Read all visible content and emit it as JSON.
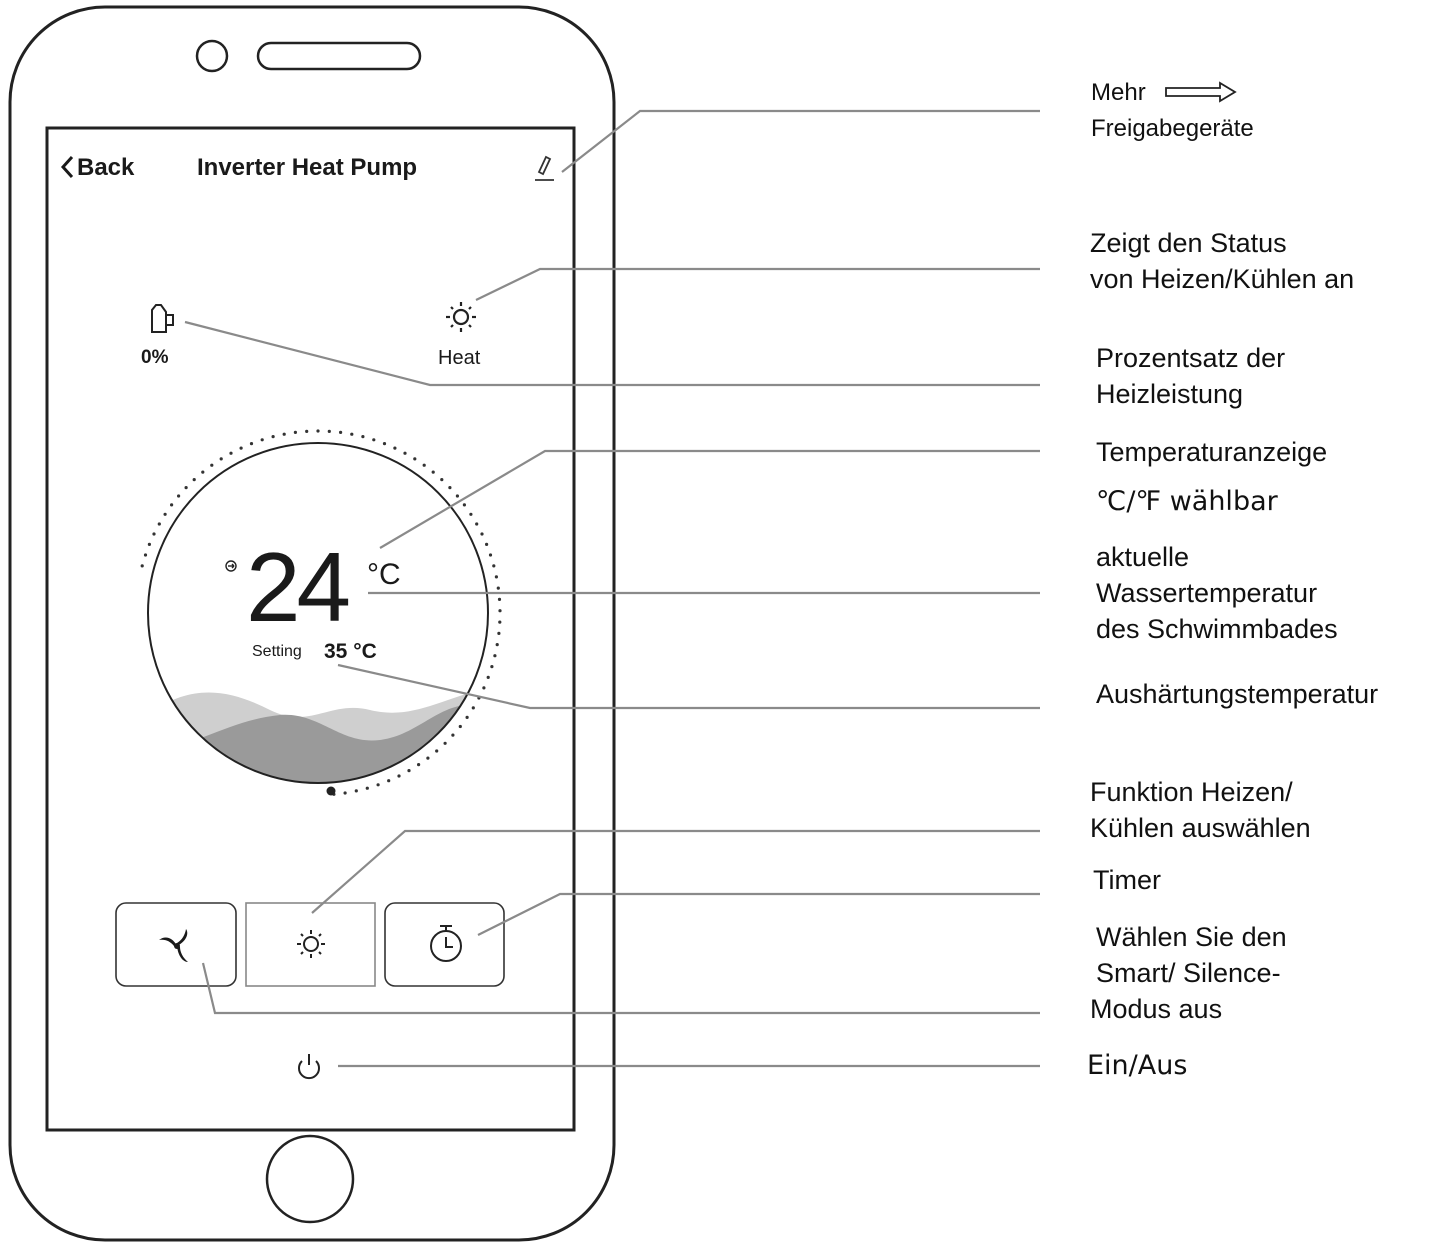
{
  "app": {
    "back_label": "Back",
    "title": "Inverter Heat Pump",
    "power_percent": "0%",
    "mode_label": "Heat",
    "current_temp": "24",
    "temp_unit": "°C",
    "setting_label": "Setting",
    "setting_value": "35 °C"
  },
  "annotations": {
    "share_more": "Mehr",
    "share_devices": "Freigabegeräte",
    "mode_status_1": "Zeigt den Status",
    "mode_status_2": "von Heizen/Kühlen an",
    "power_1": "Prozentsatz der",
    "power_2": "Heizleistung",
    "temp_display": "Temperaturanzeige",
    "unit_select": "℃/℉ wählbar",
    "water_1": "aktuelle",
    "water_2": "Wassertemperatur",
    "water_3": "des Schwimmbades",
    "setpoint": "Aushärtungstemperatur",
    "mode_select_1": "Funktion Heizen/",
    "mode_select_2": "Kühlen auswählen",
    "timer": "Timer",
    "fan_1": "Wählen Sie den",
    "fan_2": "Smart/ Silence-",
    "fan_3": "Modus aus",
    "power_toggle": "Ein/Aus"
  }
}
